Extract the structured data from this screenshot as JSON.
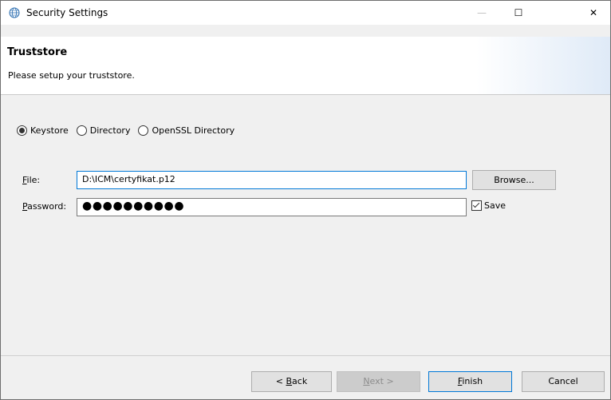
{
  "window": {
    "title": "Security Settings"
  },
  "title_bar": {
    "minimize": "—",
    "maximize": "☐",
    "close": "✕"
  },
  "banner": {
    "title": "Truststore",
    "description": "Please setup your truststore."
  },
  "source_type": {
    "options": [
      {
        "label": "Keystore",
        "checked": true
      },
      {
        "label": "Directory",
        "checked": false
      },
      {
        "label": "OpenSSL Directory",
        "checked": false
      }
    ]
  },
  "file": {
    "label_accel": "F",
    "label_rest": "ile:",
    "value": "D:\\ICM\\certyfikat.p12",
    "browse_label": "Browse..."
  },
  "password": {
    "label_accel": "P",
    "label_rest": "assword:",
    "mask": "●●●●●●●●●●",
    "save_label": "Save",
    "save_checked": true
  },
  "footer": {
    "back_prefix": "< ",
    "back_accel": "B",
    "back_rest": "ack",
    "next_accel": "N",
    "next_rest": "ext >",
    "finish_accel": "F",
    "finish_rest": "inish",
    "cancel_label": "Cancel"
  }
}
